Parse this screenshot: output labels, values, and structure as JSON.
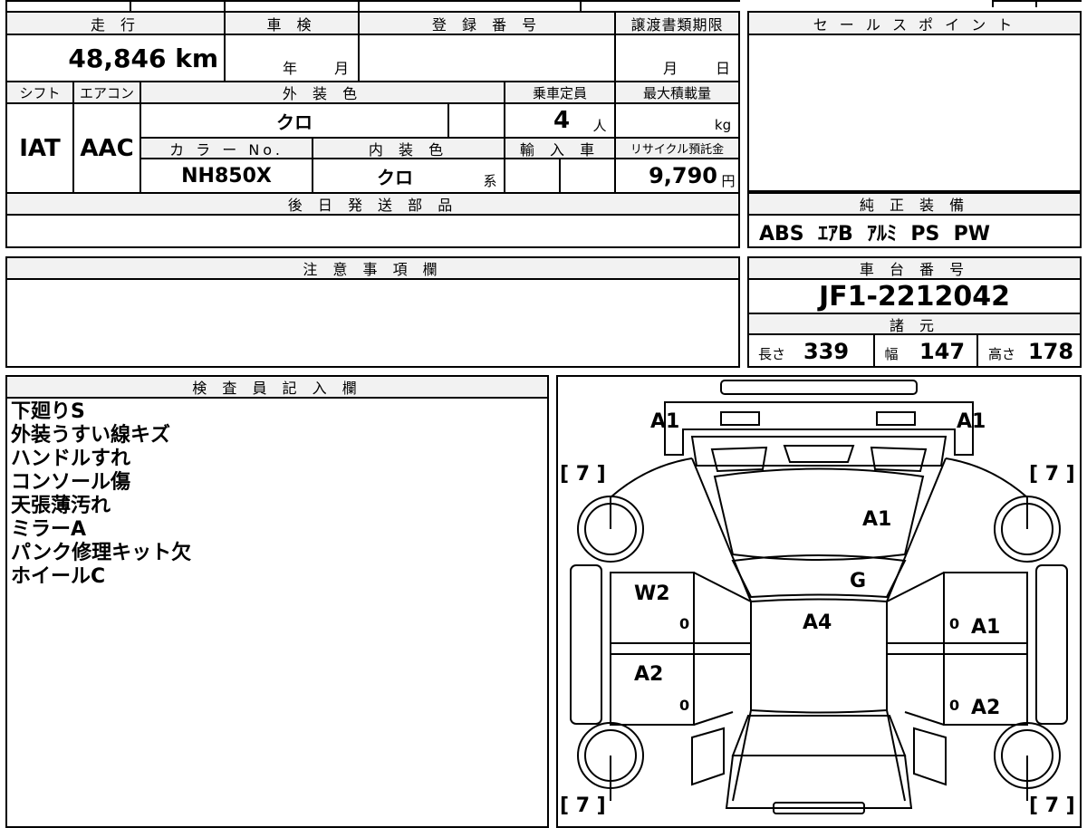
{
  "top_table": {
    "mileage_label": "走 行",
    "mileage_value": "48,846 km",
    "inspection_label": "車 検",
    "inspection_year": "年",
    "inspection_month": "月",
    "registration_label": "登 録 番 号",
    "transfer_label": "譲渡書類期限",
    "transfer_month": "月",
    "transfer_day": "日",
    "shift_label": "シフト",
    "shift_value": "IAT",
    "ac_label": "エアコン",
    "ac_value": "AAC",
    "exterior_color_label": "外 装 色",
    "exterior_color_value": "クロ",
    "capacity_label": "乗車定員",
    "capacity_value": "4",
    "capacity_unit": "人",
    "max_load_label": "最大積載量",
    "max_load_unit": "kg",
    "color_no_label": "カ ラ ー No.",
    "color_no_value": "NH850X",
    "interior_color_label": "内 装 色",
    "interior_color_value": "クロ",
    "interior_color_suffix": "系",
    "import_label": "輸 入 車",
    "recycle_label": "リサイクル預託金",
    "recycle_value": "9,790",
    "recycle_unit": "円",
    "later_parts_label": "後 日 発 送 部 品"
  },
  "sales_point": {
    "label": "セ ー ル ス ポ イ ン ト"
  },
  "equipment": {
    "label": "純 正 装 備",
    "value": "ABS  ｴｱB  ｱﾙﾐ  PS  PW"
  },
  "caution": {
    "label": "注 意 事 項 欄"
  },
  "chassis": {
    "label": "車 台 番 号",
    "value": "JF1-2212042",
    "specs_label": "諸 元",
    "length_label": "長さ",
    "length_value": "339",
    "width_label": "幅",
    "width_value": "147",
    "height_label": "高さ",
    "height_value": "178"
  },
  "inspector": {
    "label": "検 査 員 記 入 欄",
    "notes": [
      "下廻りS",
      "外装うすい線キズ",
      "ハンドルすれ",
      "コンソール傷",
      "天張薄汚れ",
      "ミラーA",
      "パンク修理キット欠",
      "ホイールC"
    ]
  },
  "diagram": {
    "marks": {
      "front_left_corner": "A1",
      "front_right_corner": "A1",
      "hood": "A1",
      "windshield": "G",
      "roof": "A4",
      "left_front_door": "W2",
      "left_rear_door": "A2",
      "right_front_door": "A1",
      "right_rear_door": "A2",
      "tire_fl": "[ 7 ]",
      "tire_fr": "[ 7 ]",
      "tire_rl": "[ 7 ]",
      "tire_rr": "[ 7 ]",
      "handle_1": "0",
      "handle_2": "0",
      "handle_3": "0",
      "handle_4": "0"
    }
  }
}
